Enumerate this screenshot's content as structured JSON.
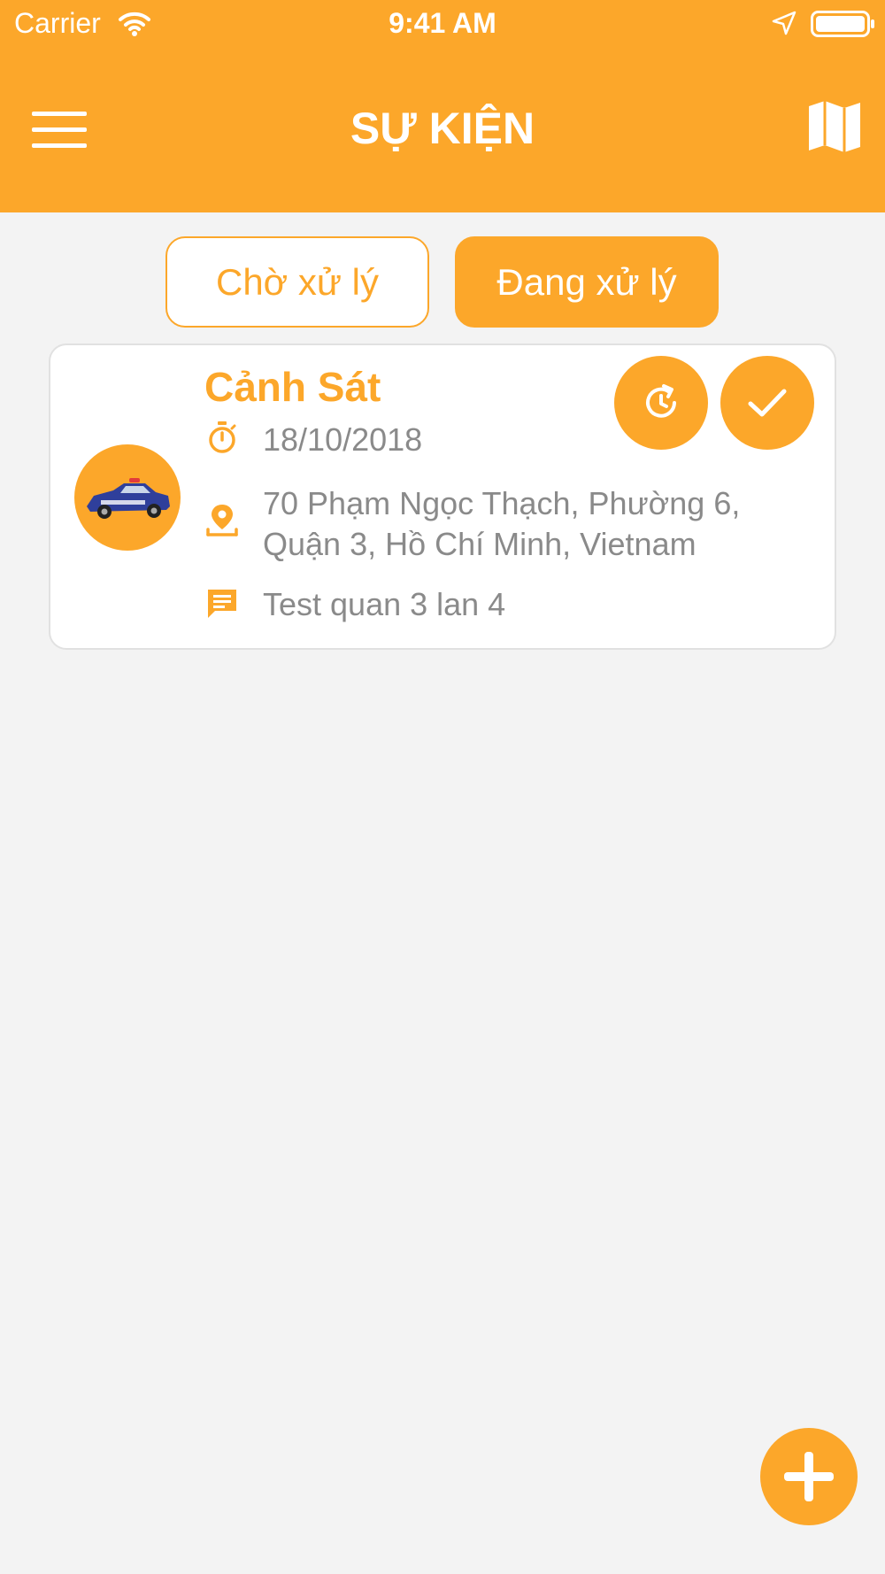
{
  "status_bar": {
    "carrier": "Carrier",
    "time": "9:41 AM",
    "icons": [
      "wifi-icon",
      "location-arrow-icon",
      "battery-icon"
    ]
  },
  "header": {
    "title": "SỰ KIỆN",
    "left_icon": "menu-icon",
    "right_icon": "map-icon"
  },
  "tabs": [
    {
      "label": "Chờ xử lý",
      "active": false
    },
    {
      "label": "Đang xử lý",
      "active": true
    }
  ],
  "events": [
    {
      "title": "Cảnh Sát",
      "avatar_icon": "police-car-icon",
      "date": "18/10/2018",
      "address_line1": "70 Phạm Ngọc Thạch, Phường 6,",
      "address_line2": "Quận 3, Hồ Chí Minh, Vietnam",
      "note": "Test quan 3 lan 4",
      "actions": [
        "history-icon",
        "check-icon"
      ]
    }
  ],
  "fab": {
    "icon": "plus-icon"
  },
  "colors": {
    "accent": "#fca72a",
    "background": "#f3f3f3",
    "card": "#ffffff",
    "muted_text": "#8a8a8a"
  }
}
